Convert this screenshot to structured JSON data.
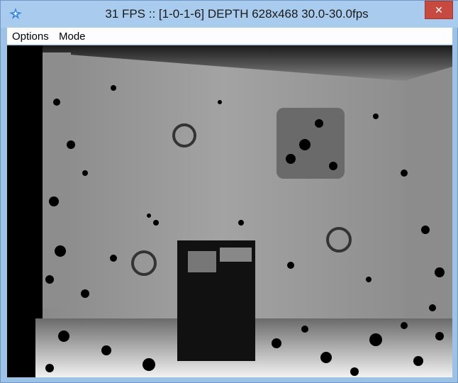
{
  "window": {
    "title": "31 FPS :: [1-0-1-6] DEPTH 628x468 30.0-30.0fps",
    "close_glyph": "✕",
    "app_icon": "sparkle-app-icon"
  },
  "menu": {
    "items": [
      "Options",
      "Mode"
    ]
  },
  "viewport": {
    "content": "depth-image",
    "colors": {
      "background": "#000000",
      "wall": "#9a9a9a",
      "floor": "#e8e8e8"
    }
  },
  "colors": {
    "titlebar": "#a9cbee",
    "close_button": "#c74a40",
    "menubar": "#fdfdfd"
  }
}
